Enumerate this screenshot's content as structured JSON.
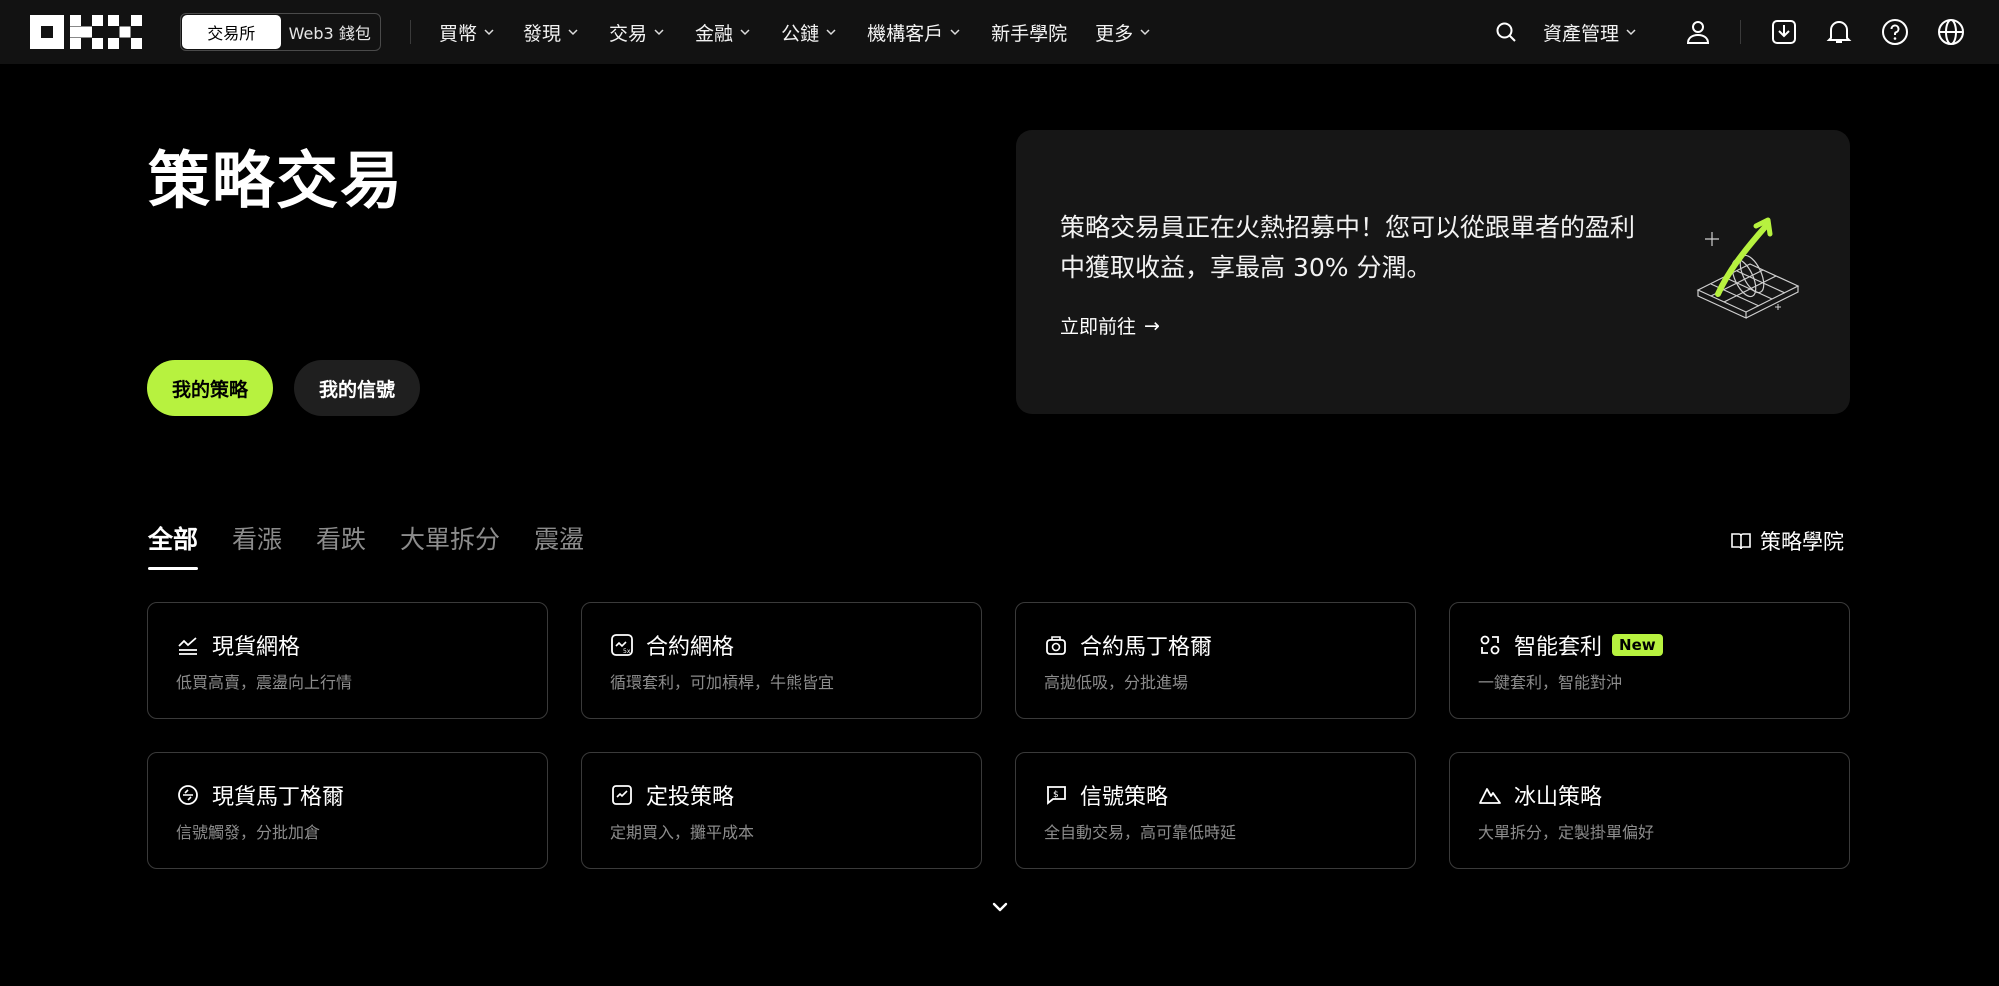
{
  "nav": {
    "switcher": [
      "交易所",
      "Web3 錢包"
    ],
    "links": [
      "買幣",
      "發現",
      "交易",
      "金融",
      "公鏈",
      "機構客戶",
      "新手學院",
      "更多"
    ],
    "asset_mgmt": "資產管理"
  },
  "hero": {
    "title": "策略交易",
    "btn_my_strategies": "我的策略",
    "btn_my_signals": "我的信號"
  },
  "promo": {
    "text": "策略交易員正在火熱招募中！您可以從跟單者的盈利中獲取收益，享最高 30% 分潤。",
    "link": "立即前往",
    "link_arrow": "→"
  },
  "tabs": [
    "全部",
    "看漲",
    "看跌",
    "大單拆分",
    "震盪"
  ],
  "academy": "策略學院",
  "cards": [
    {
      "title": "現貨網格",
      "desc": "低買高賣，震盪向上行情",
      "icon": "spot-grid-icon"
    },
    {
      "title": "合約網格",
      "desc": "循環套利，可加槓桿，牛熊皆宜",
      "icon": "futures-grid-icon"
    },
    {
      "title": "合約馬丁格爾",
      "desc": "高拋低吸，分批進場",
      "icon": "futures-martingale-icon"
    },
    {
      "title": "智能套利",
      "desc": "一鍵套利，智能對沖",
      "icon": "smart-arbitrage-icon",
      "badge": "New"
    },
    {
      "title": "現貨馬丁格爾",
      "desc": "信號觸發，分批加倉",
      "icon": "spot-martingale-icon"
    },
    {
      "title": "定投策略",
      "desc": "定期買入，攤平成本",
      "icon": "recurring-buy-icon"
    },
    {
      "title": "信號策略",
      "desc": "全自動交易，高可靠低時延",
      "icon": "signal-strategy-icon"
    },
    {
      "title": "冰山策略",
      "desc": "大單拆分，定製掛單偏好",
      "icon": "iceberg-icon"
    }
  ],
  "colors": {
    "accent": "#b7f23f",
    "bg": "#000000",
    "nav_bg": "#121212",
    "card_border": "#3a3a3a",
    "promo_bg": "#161616",
    "muted_text": "#8c8c8c"
  }
}
